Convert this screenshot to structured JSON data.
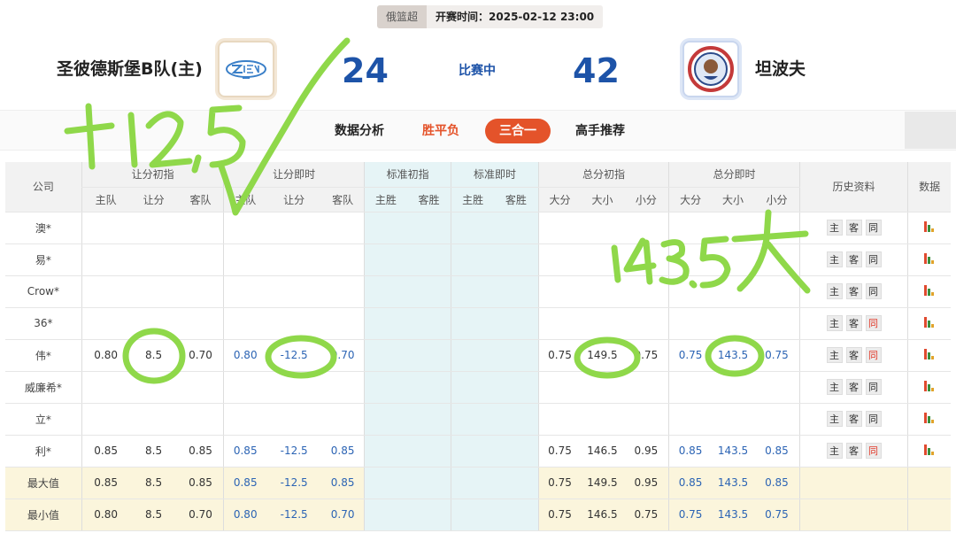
{
  "header": {
    "league": "俄篮超",
    "open_time": "开赛时间：2025-02-12 23:00",
    "home_team": "圣彼德斯堡B队(主)",
    "away_team": "坦波夫",
    "home_score": "24",
    "away_score": "42",
    "status": "比赛中"
  },
  "nav": {
    "items": [
      "数据分析",
      "胜平负",
      "三合一",
      "高手推荐"
    ],
    "active": "三合一"
  },
  "table": {
    "group_headers": [
      "公司",
      "让分初指",
      "让分即时",
      "标准初指",
      "标准即时",
      "总分初指",
      "总分即时",
      "历史资料",
      "数据"
    ],
    "sub_headers": [
      "主队",
      "让分",
      "客队",
      "主队",
      "让分",
      "客队",
      "主胜",
      "客胜",
      "主胜",
      "客胜",
      "大分",
      "大小",
      "小分",
      "大分",
      "大小",
      "小分"
    ],
    "history_buttons": [
      "主",
      "客",
      "同"
    ],
    "rows": [
      {
        "company": "澳*",
        "cells": [
          "",
          "",
          "",
          "",
          "",
          "",
          "",
          "",
          "",
          "",
          "",
          "",
          ""
        ],
        "same_red": false
      },
      {
        "company": "易*",
        "cells": [
          "",
          "",
          "",
          "",
          "",
          "",
          "",
          "",
          "",
          "",
          "",
          "",
          ""
        ],
        "same_red": false
      },
      {
        "company": "Crow*",
        "cells": [
          "",
          "",
          "",
          "",
          "",
          "",
          "",
          "",
          "",
          "",
          "",
          "",
          ""
        ],
        "same_red": false
      },
      {
        "company": "36*",
        "cells": [
          "",
          "",
          "",
          "",
          "",
          "",
          "",
          "",
          "",
          "",
          "",
          "",
          ""
        ],
        "same_red": true
      },
      {
        "company": "伟*",
        "cells": [
          "0.80",
          "8.5",
          "0.70",
          "0.80",
          "-12.5",
          "0.70",
          "0.75",
          "149.5",
          "0.75",
          "0.75",
          "143.5",
          "0.75"
        ],
        "same_red": true
      },
      {
        "company": "威廉希*",
        "cells": [
          "",
          "",
          "",
          "",
          "",
          "",
          "",
          "",
          "",
          "",
          "",
          ""
        ],
        "same_red": false
      },
      {
        "company": "立*",
        "cells": [
          "",
          "",
          "",
          "",
          "",
          "",
          "",
          "",
          "",
          "",
          "",
          ""
        ],
        "same_red": false
      },
      {
        "company": "利*",
        "cells": [
          "0.85",
          "8.5",
          "0.85",
          "0.85",
          "-12.5",
          "0.85",
          "0.75",
          "146.5",
          "0.95",
          "0.85",
          "143.5",
          "0.85"
        ],
        "same_red": true
      }
    ],
    "max_row": {
      "label": "最大值",
      "cells": [
        "0.85",
        "8.5",
        "0.85",
        "0.85",
        "-12.5",
        "0.85",
        "0.75",
        "149.5",
        "0.95",
        "0.85",
        "143.5",
        "0.85"
      ]
    },
    "min_row": {
      "label": "最小值",
      "cells": [
        "0.80",
        "8.5",
        "0.70",
        "0.80",
        "-12.5",
        "0.70",
        "0.75",
        "146.5",
        "0.75",
        "0.75",
        "143.5",
        "0.75"
      ]
    }
  },
  "annotations": {
    "handicap_note": "+12.5",
    "total_note": "143.5大",
    "color": "#8fd84a"
  },
  "colors": {
    "accent_orange": "#e4532a",
    "score_blue": "#1d53a8",
    "odds_blue": "#2c64b4",
    "mid_column_bg": "#e6f4f6",
    "maxmin_bg": "#fbf5dc"
  }
}
